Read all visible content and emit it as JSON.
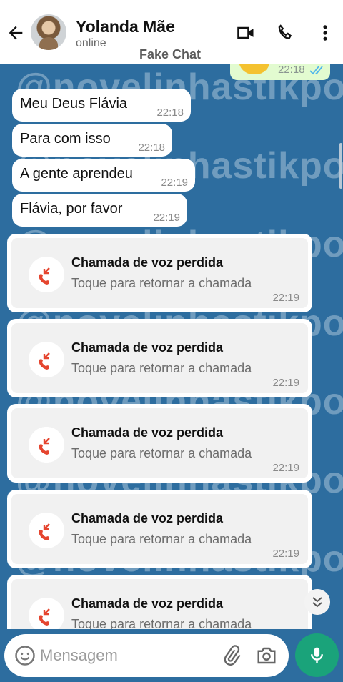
{
  "header": {
    "contact_name": "Yolanda Mãe",
    "status": "online",
    "app_label": "Fake Chat"
  },
  "watermark": {
    "text": "@novelinhastikpop"
  },
  "outgoing_top": {
    "time": "22:18"
  },
  "messages": [
    {
      "text": "Meu Deus Flávia",
      "time": "22:18"
    },
    {
      "text": "Para com isso",
      "time": "22:18"
    },
    {
      "text": "A gente aprendeu",
      "time": "22:19"
    },
    {
      "text": "Flávia, por favor",
      "time": "22:19"
    }
  ],
  "missed_calls": [
    {
      "title": "Chamada de voz perdida",
      "subtitle": "Toque para retornar a chamada",
      "time": "22:19"
    },
    {
      "title": "Chamada de voz perdida",
      "subtitle": "Toque para retornar a chamada",
      "time": "22:19"
    },
    {
      "title": "Chamada de voz perdida",
      "subtitle": "Toque para retornar a chamada",
      "time": "22:19"
    },
    {
      "title": "Chamada de voz perdida",
      "subtitle": "Toque para retornar a chamada",
      "time": "22:19"
    },
    {
      "title": "Chamada de voz perdida",
      "subtitle": "Toque para retornar a chamada",
      "time": ""
    }
  ],
  "composer": {
    "placeholder": "Mensagem"
  },
  "colors": {
    "wallpaper": "#2d6d9f",
    "missed_call_red": "#e5452f",
    "mic_green": "#1aa37a",
    "read_ticks": "#4fb6ec"
  }
}
